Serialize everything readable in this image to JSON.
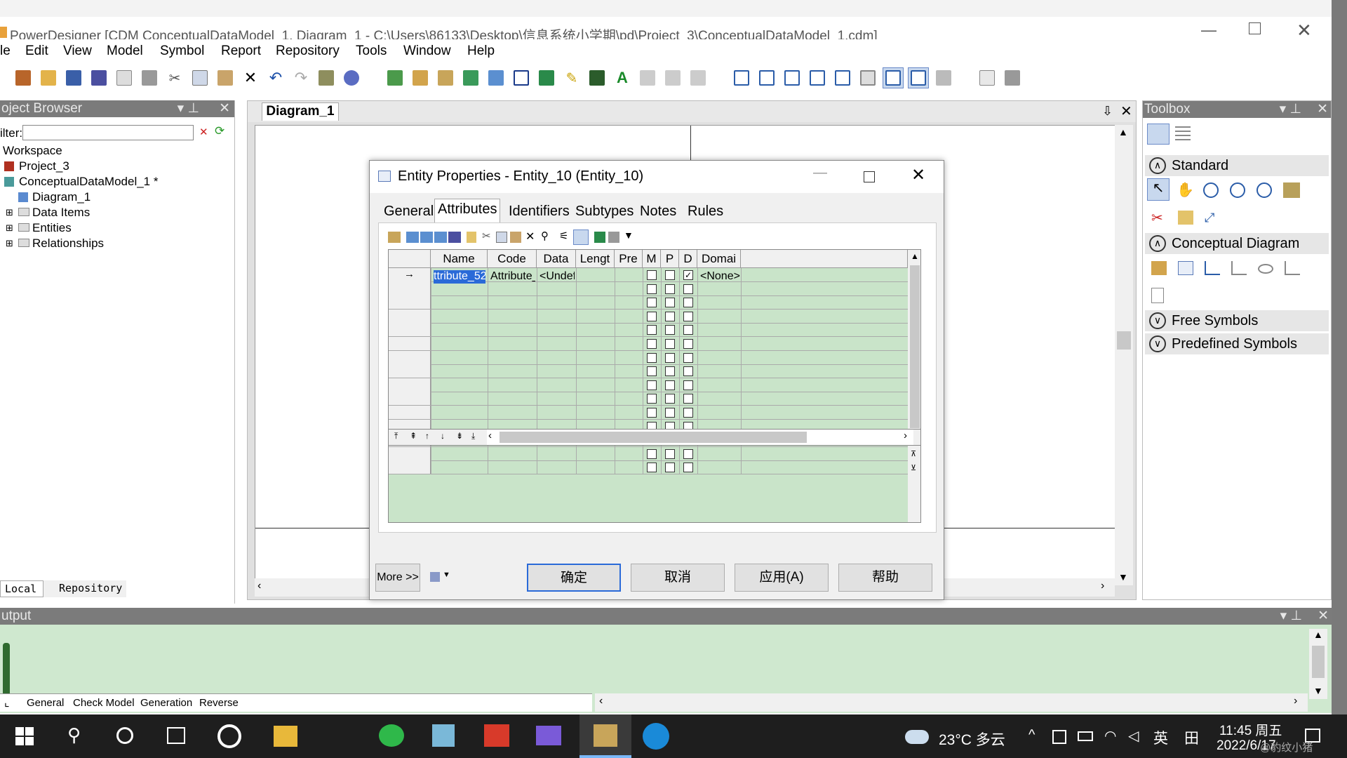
{
  "app": {
    "title": "PowerDesigner [CDM ConceptualDataModel_1, Diagram_1 - C:\\Users\\86133\\Desktop\\信息系统小学期\\pd\\Project_3\\ConceptualDataModel_1.cdm]"
  },
  "menu": [
    "le",
    "Edit",
    "View",
    "Model",
    "Symbol",
    "Report",
    "Repository",
    "Tools",
    "Window",
    "Help"
  ],
  "browser": {
    "title": "oject Browser",
    "filter_label": "ilter:",
    "filter_value": "",
    "items": [
      "Workspace",
      "Project_3",
      "ConceptualDataModel_1 *",
      "Diagram_1",
      "Data Items",
      "Entities",
      "Relationships"
    ],
    "tabs": [
      "Local",
      "Repository"
    ]
  },
  "diagram": {
    "tab": "Diagram_1"
  },
  "toolbox": {
    "title": "Toolbox",
    "sections": [
      "Standard",
      "Conceptual Diagram",
      "Free Symbols",
      "Predefined Symbols"
    ]
  },
  "output": {
    "title": "utput",
    "tabs": [
      "General",
      "Check Model",
      "Generation",
      "Reverse"
    ]
  },
  "dialog": {
    "title": "Entity Properties - Entity_10 (Entity_10)",
    "tabs": [
      "General",
      "Attributes",
      "Identifiers",
      "Subtypes",
      "Notes",
      "Rules"
    ],
    "active_tab": "Attributes",
    "columns": [
      "Name",
      "Code",
      "Data",
      "Lengt",
      "Pre",
      "M",
      "P",
      "D",
      "Domai"
    ],
    "row": {
      "name": "ttribute_52",
      "code": "Attribute_",
      "data": "<Undefi",
      "domain": "<None>",
      "m": false,
      "p": false,
      "d": true
    },
    "empty_rows": 14,
    "more": "More >>",
    "buttons": {
      "ok": "确定",
      "cancel": "取消",
      "apply": "应用(A)",
      "help": "帮助"
    }
  },
  "taskbar": {
    "weather": "23°C 多云",
    "lang": "英",
    "time": "11:45 周五",
    "date": "2022/6/17",
    "watermark": "@豹纹小猪"
  }
}
